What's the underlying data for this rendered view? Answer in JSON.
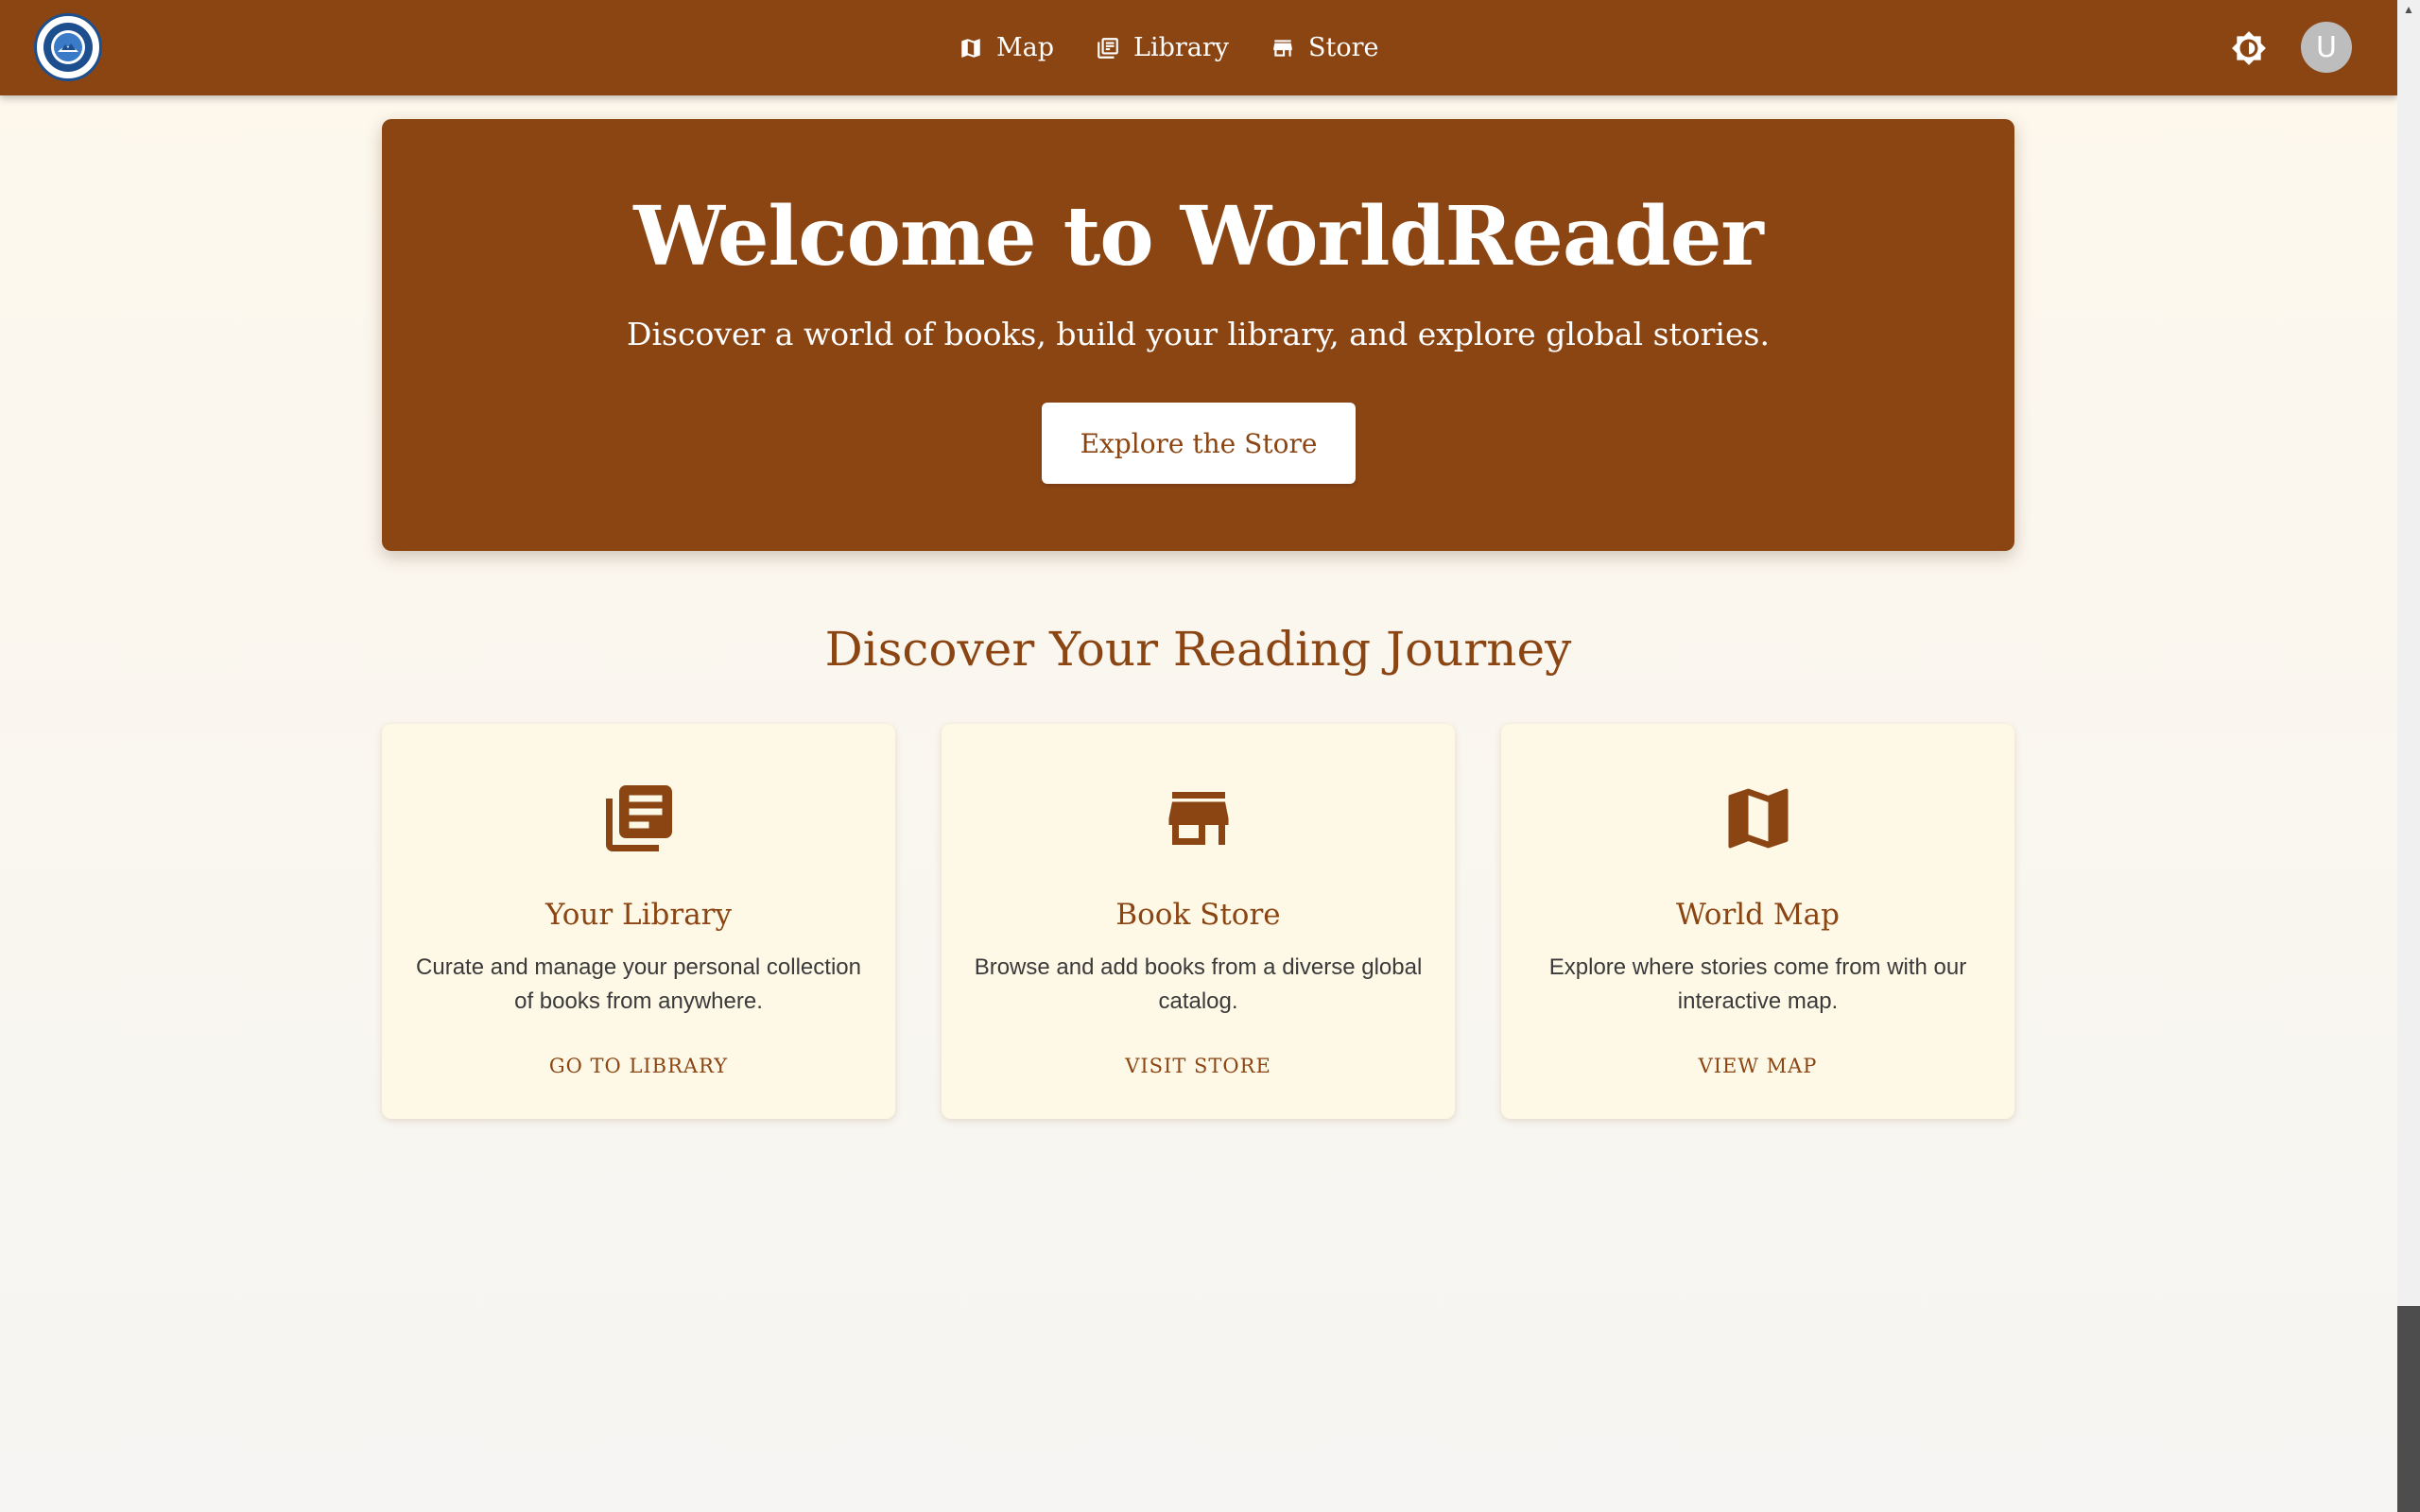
{
  "header": {
    "logo_icon": "globe-seal-icon",
    "nav": [
      {
        "label": "Map",
        "icon": "map-icon"
      },
      {
        "label": "Library",
        "icon": "library-books-icon"
      },
      {
        "label": "Store",
        "icon": "store-icon"
      }
    ],
    "theme_toggle_icon": "brightness-icon",
    "avatar_initial": "U"
  },
  "hero": {
    "title": "Welcome to WorldReader",
    "subtitle": "Discover a world of books, build your library, and explore global stories.",
    "button_label": "Explore the Store"
  },
  "section": {
    "title": "Discover Your Reading Journey"
  },
  "cards": [
    {
      "icon": "library-books-icon",
      "title": "Your Library",
      "description": "Curate and manage your personal collection of books from anywhere.",
      "link": "GO TO LIBRARY"
    },
    {
      "icon": "store-icon",
      "title": "Book Store",
      "description": "Browse and add books from a diverse global catalog.",
      "link": "VISIT STORE"
    },
    {
      "icon": "map-icon",
      "title": "World Map",
      "description": "Explore where stories come from with our interactive map.",
      "link": "VIEW MAP"
    }
  ],
  "colors": {
    "brand": "#8b4513",
    "card_bg": "#fef8e6",
    "page_bg": "#fef8ec"
  }
}
